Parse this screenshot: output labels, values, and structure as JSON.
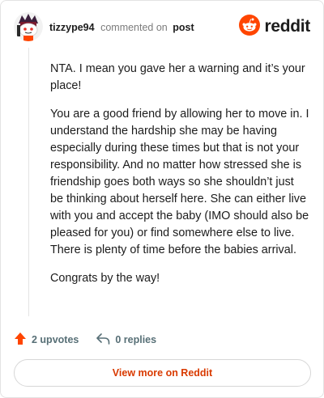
{
  "header": {
    "username": "tizzype94",
    "verb": "commented on",
    "post_link": "post",
    "brand_name": "reddit",
    "brand_color": "#ff4500",
    "avatar_icon": "snoo-avatar-icon",
    "logo_icon": "reddit-logo-icon"
  },
  "comment": {
    "paragraphs": [
      "NTA. I mean you gave her a warning and it’s your place!",
      "You are a good friend by allowing her to move in. I understand the hardship she may be having especially during these times but that is not your responsibility. And no matter how stressed she is friendship goes both ways so she shouldn’t just be thinking about herself here. She can either live with you and accept the baby (IMO should also be pleased for you) or find somewhere else to live. There is plenty of time before the babies arrival.",
      "Congrats by the way!"
    ]
  },
  "actions": {
    "upvotes": "2 upvotes",
    "replies": "0 replies",
    "upvote_icon": "upvote-arrow-icon",
    "reply_icon": "reply-arrow-icon",
    "upvote_color": "#ff4500"
  },
  "footer": {
    "view_more": "View more on Reddit",
    "link_color": "#d93a00"
  }
}
